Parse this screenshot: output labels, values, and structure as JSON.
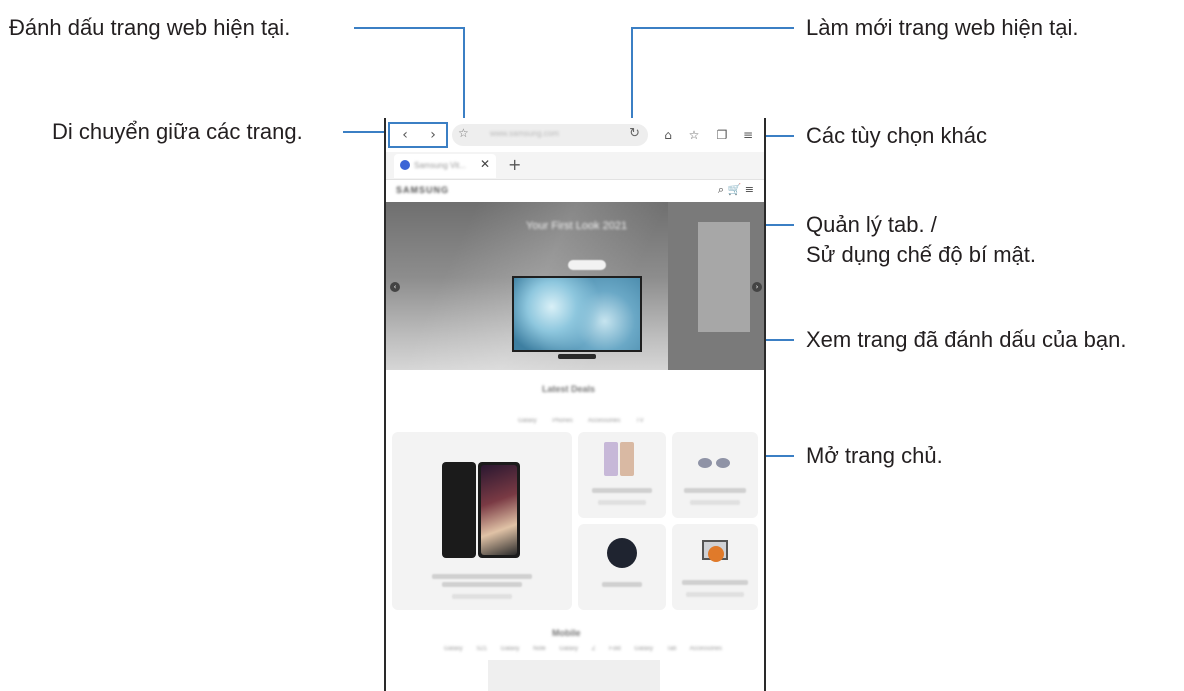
{
  "callouts": {
    "bookmark_current": "Đánh dấu trang web hiện tại.",
    "navigate": "Di chuyển giữa các trang.",
    "refresh": "Làm mới trang web hiện tại.",
    "more_options": "Các tùy chọn khác",
    "tab_manager_line1": "Quản lý tab. /",
    "tab_manager_line2": "Sử dụng chế độ bí mật.",
    "view_bookmarks": "Xem trang đã đánh dấu của bạn.",
    "open_home": "Mở trang chủ."
  },
  "browser": {
    "url": "www.samsung.com",
    "tab_title": "Samsung Vit...",
    "site_logo": "SAMSUNG",
    "hero_title": "Your First Look 2021",
    "deals_title": "Latest Deals",
    "deals_tabs": "Galaxy Phones Accessories TV",
    "mobile_title": "Mobile",
    "mobile_tabs": "Galaxy S21 Galaxy Note Galaxy Z Fold Galaxy Tab Accessories"
  },
  "icons": {
    "back": "chevron-left-icon",
    "forward": "chevron-right-icon",
    "bookmark_star": "star-outline-icon",
    "reload": "refresh-icon",
    "home": "home-icon",
    "bookmarks": "star-outline-icon",
    "tabs": "tabs-icon",
    "menu": "menu-icon"
  },
  "colors": {
    "nav_highlight": "#3b7fc4",
    "leader_line": "#3b7fc4",
    "label_text": "#231f20"
  }
}
